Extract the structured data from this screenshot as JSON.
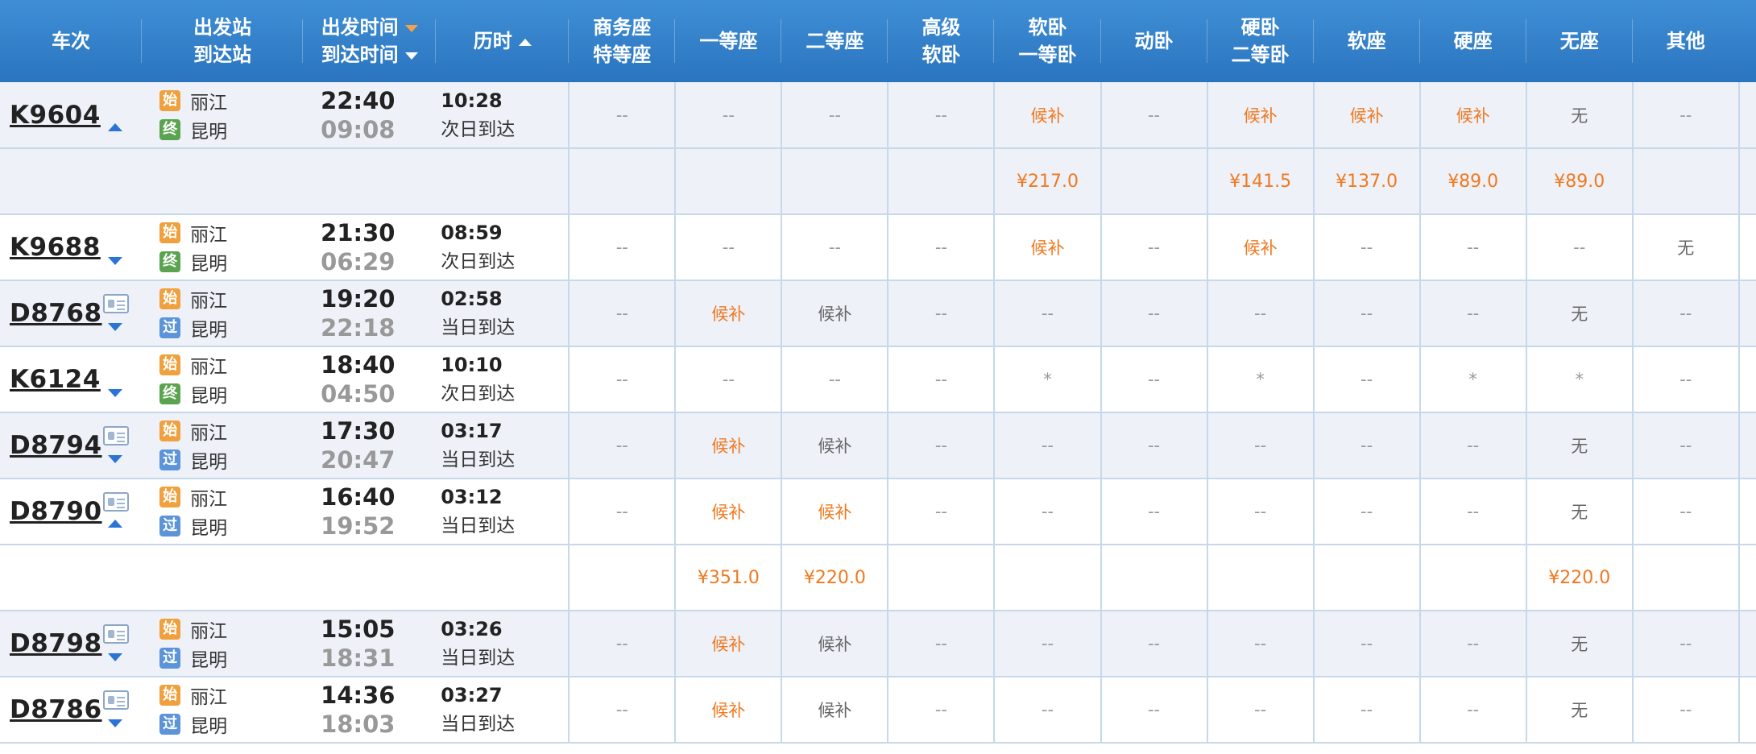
{
  "header": {
    "train": "车次",
    "station_l1": "出发站",
    "station_l2": "到达站",
    "time_l1": "出发时间",
    "time_l2": "到达时间",
    "duration": "历时",
    "seats": [
      {
        "l1": "商务座",
        "l2": "特等座"
      },
      {
        "l1": "一等座",
        "l2": ""
      },
      {
        "l1": "二等座",
        "l2": ""
      },
      {
        "l1": "高级",
        "l2": "软卧"
      },
      {
        "l1": "软卧",
        "l2": "一等卧"
      },
      {
        "l1": "动卧",
        "l2": ""
      },
      {
        "l1": "硬卧",
        "l2": "二等卧"
      },
      {
        "l1": "软座",
        "l2": ""
      },
      {
        "l1": "硬座",
        "l2": ""
      },
      {
        "l1": "无座",
        "l2": ""
      },
      {
        "l1": "其他",
        "l2": ""
      }
    ]
  },
  "badges": {
    "start": "始",
    "end": "终",
    "via": "过"
  },
  "colors": {
    "header_bg": "#2a74bf",
    "orange": "#f07920",
    "row_shade": "#eef1f8",
    "arrow_blue": "#2a74d6"
  },
  "trains": [
    {
      "no": "K9604",
      "id_icon": false,
      "arrow": "up",
      "from": "丽江",
      "to": "昆明",
      "to_badge": "end",
      "dep": "22:40",
      "arr": "09:08",
      "dur": "10:28",
      "arrive_day": "次日到达",
      "seats": [
        "--",
        "--",
        "--",
        "--",
        "候补",
        "--",
        "候补",
        "候补",
        "候补",
        "无",
        "--"
      ],
      "prices": [
        "",
        "",
        "",
        "",
        "¥217.0",
        "",
        "¥141.5",
        "¥137.0",
        "¥89.0",
        "¥89.0",
        ""
      ]
    },
    {
      "no": "K9688",
      "id_icon": false,
      "arrow": "down",
      "from": "丽江",
      "to": "昆明",
      "to_badge": "end",
      "dep": "21:30",
      "arr": "06:29",
      "dur": "08:59",
      "arrive_day": "次日到达",
      "seats": [
        "--",
        "--",
        "--",
        "--",
        "候补",
        "--",
        "候补",
        "--",
        "--",
        "--",
        "无"
      ]
    },
    {
      "no": "D8768",
      "id_icon": true,
      "arrow": "down",
      "from": "丽江",
      "to": "昆明",
      "to_badge": "via",
      "dep": "19:20",
      "arr": "22:18",
      "dur": "02:58",
      "arrive_day": "当日到达",
      "seats": [
        "--",
        "候补",
        "候补",
        "--",
        "--",
        "--",
        "--",
        "--",
        "--",
        "无",
        "--"
      ]
    },
    {
      "no": "K6124",
      "id_icon": false,
      "arrow": "down",
      "from": "丽江",
      "to": "昆明",
      "to_badge": "end",
      "dep": "18:40",
      "arr": "04:50",
      "dur": "10:10",
      "arrive_day": "次日到达",
      "seats": [
        "--",
        "--",
        "--",
        "--",
        "*",
        "--",
        "*",
        "--",
        "*",
        "*",
        "--"
      ]
    },
    {
      "no": "D8794",
      "id_icon": true,
      "arrow": "down",
      "from": "丽江",
      "to": "昆明",
      "to_badge": "via",
      "dep": "17:30",
      "arr": "20:47",
      "dur": "03:17",
      "arrive_day": "当日到达",
      "seats": [
        "--",
        "候补",
        "候补",
        "--",
        "--",
        "--",
        "--",
        "--",
        "--",
        "无",
        "--"
      ]
    },
    {
      "no": "D8790",
      "id_icon": true,
      "arrow": "up",
      "from": "丽江",
      "to": "昆明",
      "to_badge": "via",
      "dep": "16:40",
      "arr": "19:52",
      "dur": "03:12",
      "arrive_day": "当日到达",
      "seats": [
        "--",
        "候补",
        "候补",
        "--",
        "--",
        "--",
        "--",
        "--",
        "--",
        "无",
        "--"
      ],
      "prices": [
        "",
        "¥351.0",
        "¥220.0",
        "",
        "",
        "",
        "",
        "",
        "",
        "¥220.0",
        ""
      ]
    },
    {
      "no": "D8798",
      "id_icon": true,
      "arrow": "down",
      "from": "丽江",
      "to": "昆明",
      "to_badge": "via",
      "dep": "15:05",
      "arr": "18:31",
      "dur": "03:26",
      "arrive_day": "当日到达",
      "seats": [
        "--",
        "候补",
        "候补",
        "--",
        "--",
        "--",
        "--",
        "--",
        "--",
        "无",
        "--"
      ]
    },
    {
      "no": "D8786",
      "id_icon": true,
      "arrow": "down",
      "from": "丽江",
      "to": "昆明",
      "to_badge": "via",
      "dep": "14:36",
      "arr": "18:03",
      "dur": "03:27",
      "arrive_day": "当日到达",
      "seats": [
        "--",
        "候补",
        "候补",
        "--",
        "--",
        "--",
        "--",
        "--",
        "--",
        "无",
        "--"
      ]
    }
  ]
}
